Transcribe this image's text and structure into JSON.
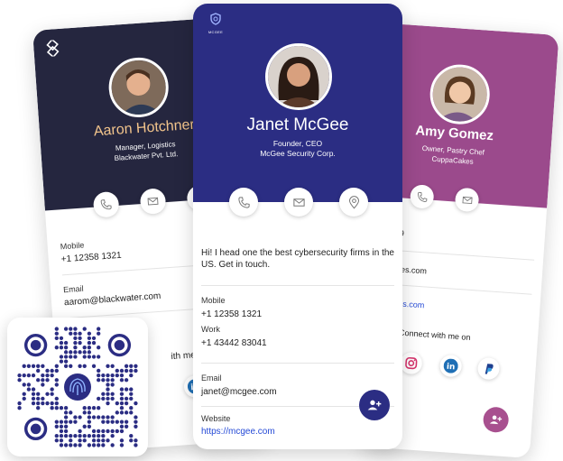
{
  "colors": {
    "navy": "#2b2d83",
    "dark": "#25263f",
    "magenta": "#9b4a8c",
    "link": "#2449d6",
    "aaron_name": "#f3c58c"
  },
  "aaron": {
    "name": "Aaron Hotchner",
    "title": "Manager, Logistics",
    "company": "Blackwater Pvt. Ltd.",
    "mobile_label": "Mobile",
    "mobile": "+1 12358 1321",
    "email_label": "Email",
    "email": "aarom@blackwater.com",
    "connect_partial": "ith me on"
  },
  "janet": {
    "logo_text": "MCGEE",
    "name": "Janet McGee",
    "title": "Founder, CEO",
    "company": "McGee Security Corp.",
    "bio": "Hi! I head one the best cybersecurity firms in the US. Get in touch.",
    "mobile_label": "Mobile",
    "mobile": "+1 12358 1321",
    "work_label": "Work",
    "work": "+1 43442 83041",
    "email_label": "Email",
    "email": "janet@mcgee.com",
    "website_label": "Website",
    "website": "https://mcgee.com"
  },
  "amy": {
    "name": "Amy Gomez",
    "title": "Owner, Pastry Chef",
    "company": "CuppaCakes",
    "phone_partial": "2359",
    "email_partial": "acakes.com",
    "website_partial": "acakes.com",
    "connect": "Connect with me on"
  },
  "icons": [
    "phone-icon",
    "mail-icon",
    "location-icon",
    "add-contact-icon",
    "instagram-icon",
    "linkedin-icon",
    "paypal-icon",
    "qr-code"
  ]
}
